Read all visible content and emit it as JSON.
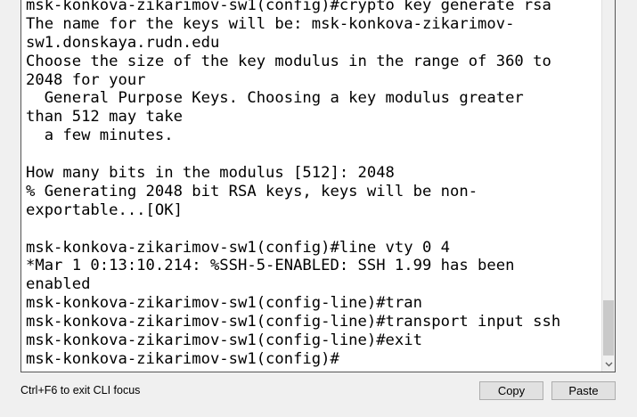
{
  "terminal": {
    "lines": [
      "msk-konkova-zikarimov-sw1(config)#crypto key generate rsa",
      "The name for the keys will be: msk-konkova-zikarimov-",
      "sw1.donskaya.rudn.edu",
      "Choose the size of the key modulus in the range of 360 to",
      "2048 for your",
      "  General Purpose Keys. Choosing a key modulus greater",
      "than 512 may take",
      "  a few minutes.",
      "",
      "How many bits in the modulus [512]: 2048",
      "% Generating 2048 bit RSA keys, keys will be non-",
      "exportable...[OK]",
      "",
      "msk-konkova-zikarimov-sw1(config)#line vty 0 4",
      "*Mar 1 0:13:10.214: %SSH-5-ENABLED: SSH 1.99 has been",
      "enabled",
      "msk-konkova-zikarimov-sw1(config-line)#tran",
      "msk-konkova-zikarimov-sw1(config-line)#transport input ssh",
      "msk-konkova-zikarimov-sw1(config-line)#exit",
      "msk-konkova-zikarimov-sw1(config)#"
    ]
  },
  "status": {
    "hint": "Ctrl+F6 to exit CLI focus"
  },
  "buttons": {
    "copy": "Copy",
    "paste": "Paste"
  },
  "icons": {
    "scroll_down": "chevron-down-icon"
  }
}
